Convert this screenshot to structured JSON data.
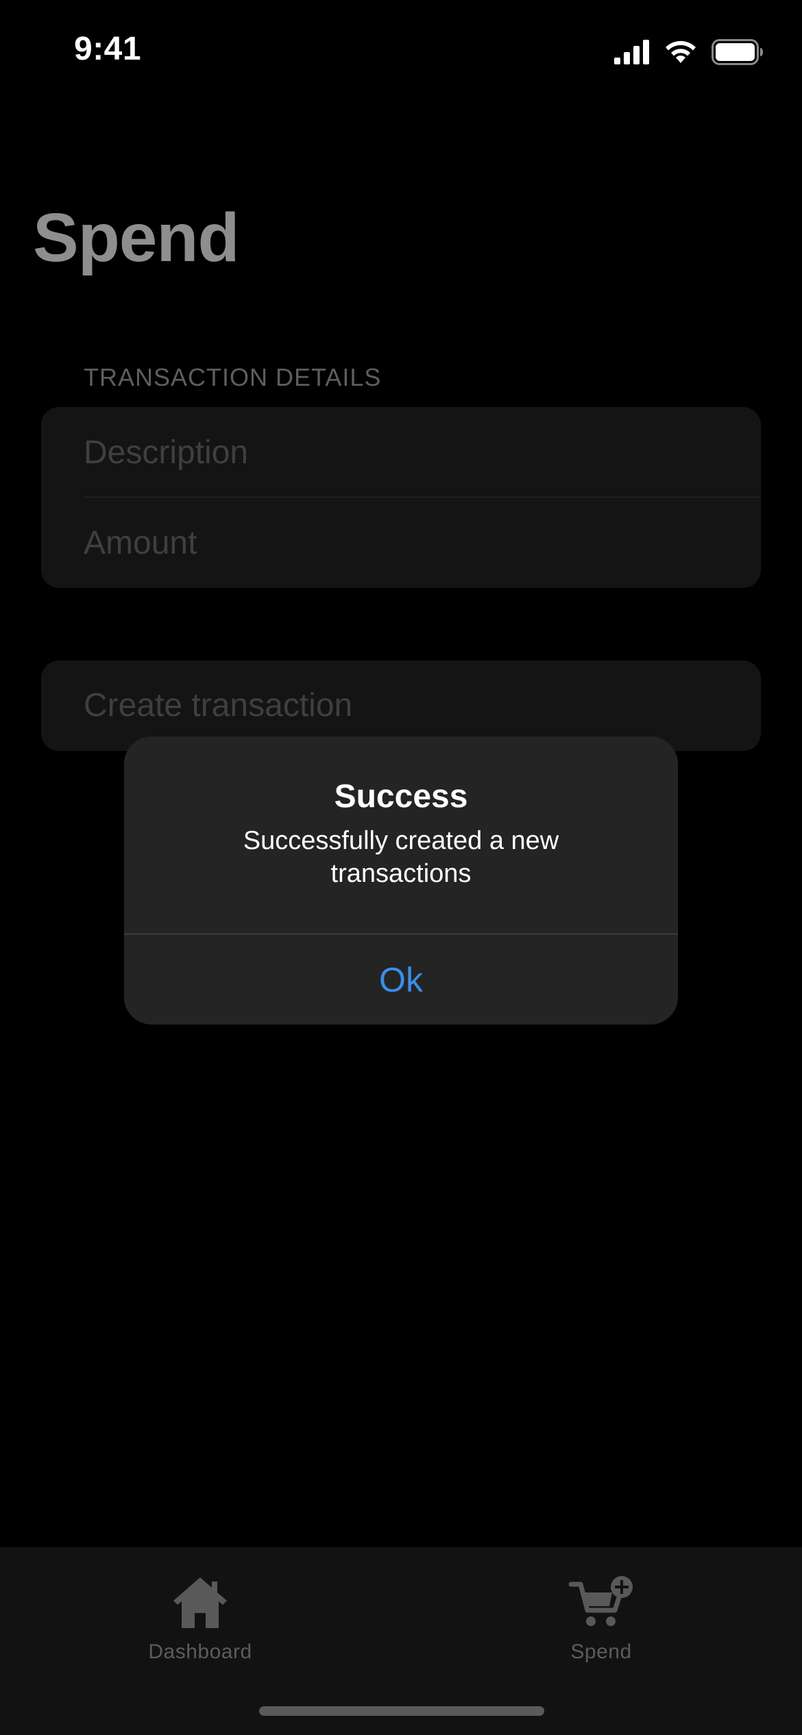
{
  "status_bar": {
    "time": "9:41",
    "icons": [
      "cellular-signal-icon",
      "wifi-icon",
      "battery-icon"
    ]
  },
  "page": {
    "title": "Spend"
  },
  "form": {
    "section_header": "TRANSACTION DETAILS",
    "description_placeholder": "Description",
    "description_value": "",
    "amount_placeholder": "Amount",
    "amount_value": "",
    "create_button_label": "Create transaction"
  },
  "alert": {
    "title": "Success",
    "message": "Successfully created a new transactions",
    "ok_label": "Ok"
  },
  "tab_bar": {
    "items": [
      {
        "label": "Dashboard",
        "icon": "house-icon"
      },
      {
        "label": "Spend",
        "icon": "cart-plus-icon"
      }
    ]
  },
  "colors": {
    "background": "#000000",
    "card": "#141414",
    "alert_background": "#242424",
    "accent": "#3b8ee8",
    "dimmed_text": "#3f3f3f",
    "title_dimmed": "#8e8e8e",
    "tab_bar": "#121212"
  }
}
